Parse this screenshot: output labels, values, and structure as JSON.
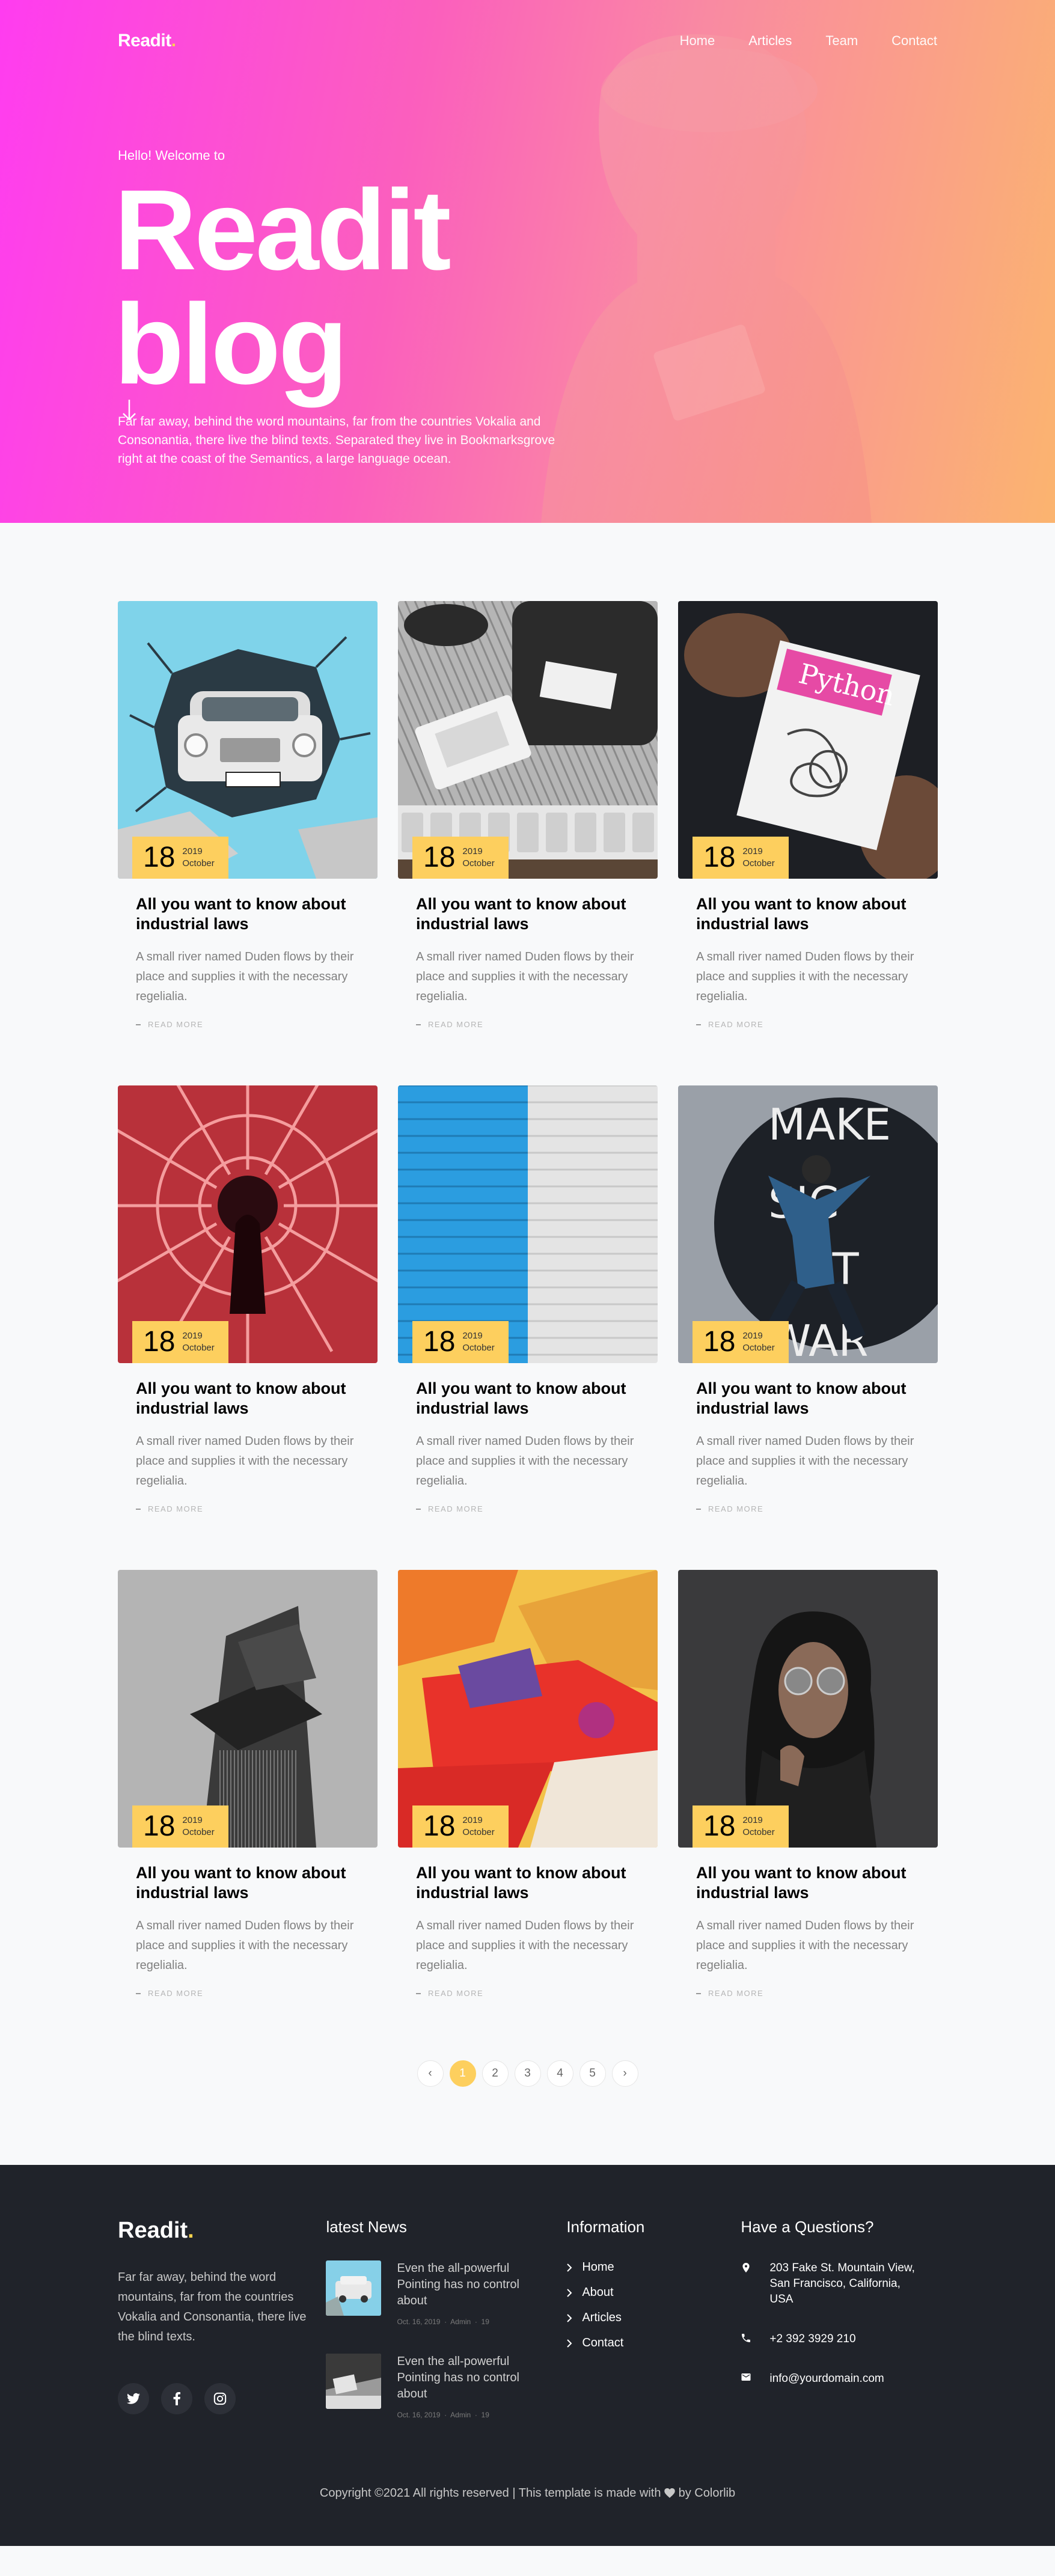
{
  "nav": {
    "logo_main": "Readit",
    "logo_dot": ".",
    "items": [
      {
        "label": "Home"
      },
      {
        "label": "Articles"
      },
      {
        "label": "Team"
      },
      {
        "label": "Contact"
      }
    ]
  },
  "hero": {
    "welcome": "Hello! Welcome to",
    "title": "Readit blog",
    "description": "Far far away, behind the word mountains, far from the countries Vokalia and Consonantia, there live the blind texts. Separated they live in Bookmarksgrove right at the coast of the Semantics, a large language ocean.",
    "scroll_icon": "arrow-down-icon"
  },
  "posts": [
    {
      "day": "18",
      "year": "2019",
      "month": "October",
      "title": "All you want to know about industrial laws",
      "excerpt": "A small river named Duden flows by their place and supplies it with the necessary regelialia.",
      "read_more": "READ MORE",
      "image": "car-wall"
    },
    {
      "day": "18",
      "year": "2019",
      "month": "October",
      "title": "All you want to know about industrial laws",
      "excerpt": "A small river named Duden flows by their place and supplies it with the necessary regelialia.",
      "read_more": "READ MORE",
      "image": "bag-flatlay"
    },
    {
      "day": "18",
      "year": "2019",
      "month": "October",
      "title": "All you want to know about industrial laws",
      "excerpt": "A small river named Duden flows by their place and supplies it with the necessary regelialia.",
      "read_more": "READ MORE",
      "image": "python-book",
      "image_text": "Python"
    },
    {
      "day": "18",
      "year": "2019",
      "month": "October",
      "title": "All you want to know about industrial laws",
      "excerpt": "A small river named Duden flows by their place and supplies it with the necessary regelialia.",
      "read_more": "READ MORE",
      "image": "neon-lights"
    },
    {
      "day": "18",
      "year": "2019",
      "month": "October",
      "title": "All you want to know about industrial laws",
      "excerpt": "A small river named Duden flows by their place and supplies it with the necessary regelialia.",
      "read_more": "READ MORE",
      "image": "brick-wall"
    },
    {
      "day": "18",
      "year": "2019",
      "month": "October",
      "title": "All you want to know about industrial laws",
      "excerpt": "A small river named Duden flows by their place and supplies it with the necessary regelialia.",
      "read_more": "READ MORE",
      "image": "mural-jump",
      "image_text": "MAKE MUSIC NOT WAR"
    },
    {
      "day": "18",
      "year": "2019",
      "month": "October",
      "title": "All you want to know about industrial laws",
      "excerpt": "A small river named Duden flows by their place and supplies it with the necessary regelialia.",
      "read_more": "READ MORE",
      "image": "building"
    },
    {
      "day": "18",
      "year": "2019",
      "month": "October",
      "title": "All you want to know about industrial laws",
      "excerpt": "A small river named Duden flows by their place and supplies it with the necessary regelialia.",
      "read_more": "READ MORE",
      "image": "abstract-paint"
    },
    {
      "day": "18",
      "year": "2019",
      "month": "October",
      "title": "All you want to know about industrial laws",
      "excerpt": "A small river named Duden flows by their place and supplies it with the necessary regelialia.",
      "read_more": "READ MORE",
      "image": "woman-portrait"
    }
  ],
  "pagination": {
    "prev": "‹",
    "pages": [
      "1",
      "2",
      "3",
      "4",
      "5"
    ],
    "active": "1",
    "next": "›"
  },
  "footer": {
    "logo_main": "Readit",
    "logo_dot": ".",
    "about": "Far far away, behind the word mountains, far from the countries Vokalia and Consonantia, there live the blind texts.",
    "social": [
      "twitter-icon",
      "facebook-icon",
      "instagram-icon"
    ],
    "news_heading": "latest News",
    "news": [
      {
        "title": "Even the all-powerful Pointing has no control about",
        "date": "Oct. 16, 2019",
        "author": "Admin",
        "comments": "19"
      },
      {
        "title": "Even the all-powerful Pointing has no control about",
        "date": "Oct. 16, 2019",
        "author": "Admin",
        "comments": "19"
      }
    ],
    "info_heading": "Information",
    "links": [
      {
        "label": "Home"
      },
      {
        "label": "About"
      },
      {
        "label": "Articles"
      },
      {
        "label": "Contact"
      }
    ],
    "contact_heading": "Have a Questions?",
    "address": "203 Fake St. Mountain View, San Francisco, California, USA",
    "phone": "+2 392 3929 210",
    "email": "info@yourdomain.com",
    "copyright_left": "Copyright ©2021 All rights reserved | This template is made with",
    "copyright_right": "by Colorlib"
  },
  "colors": {
    "accent": "#fdcf5e",
    "hero_gradient_start": "#ff3cf0",
    "hero_gradient_end": "#fbb46f",
    "footer_bg": "#20232a"
  }
}
